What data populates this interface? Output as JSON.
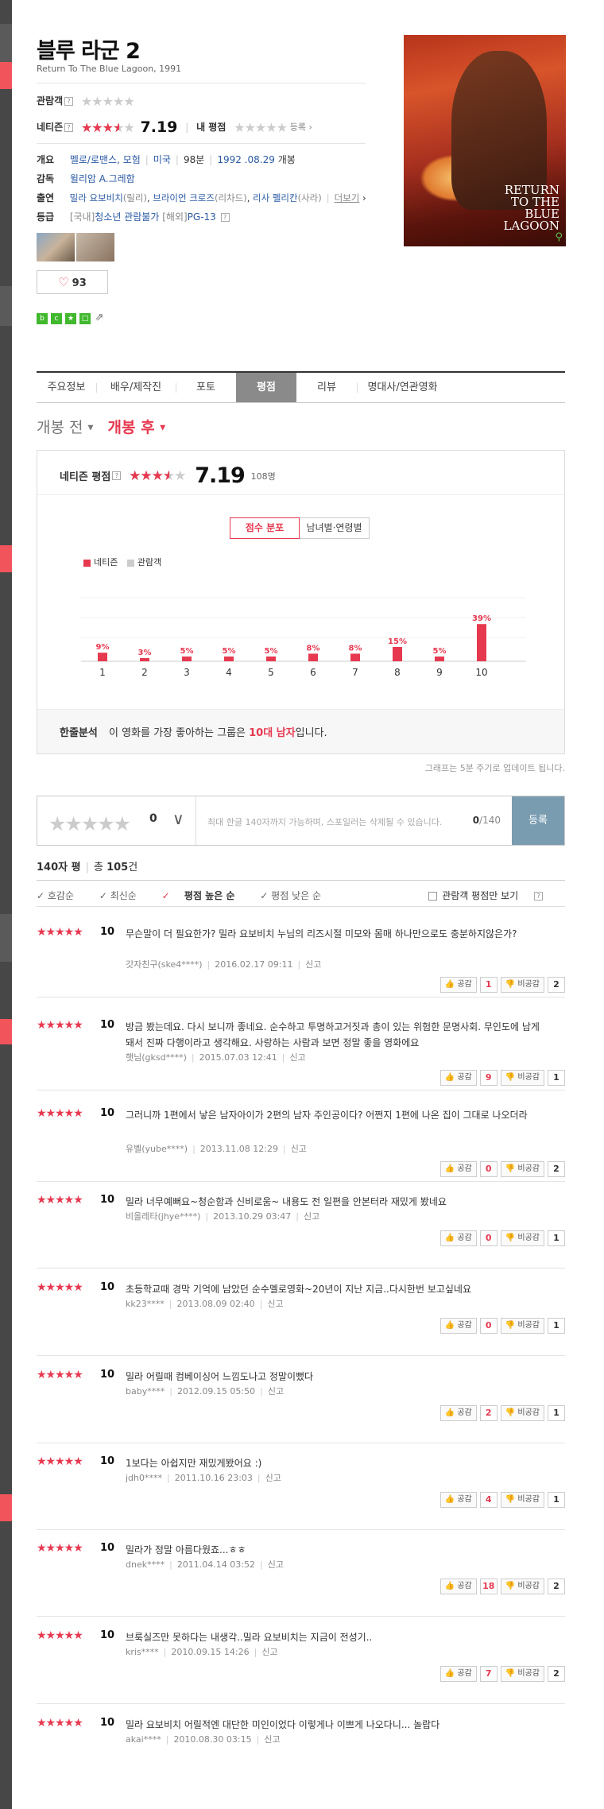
{
  "movie": {
    "title": "블루 라군 2",
    "subtitle": "Return To The Blue Lagoon, 1991",
    "audience_label": "관람객",
    "netizen_label": "네티즌",
    "netizen_score": "7.19",
    "netizen_score_value": 7.19,
    "my_rating_label": "내 평점",
    "register_label": "등록",
    "genre_label": "개요",
    "genres": "멜로/로맨스, 모험",
    "country": "미국",
    "runtime": "98분",
    "release_date": "1992 .08.29",
    "release_suffix": "개봉",
    "director_label": "감독",
    "director": "윌리암 A.그레함",
    "cast_label": "출연",
    "cast_1": "밀라 요보비치",
    "cast_1_role": "(릴리)",
    "cast_2": "브라이언 크로즈",
    "cast_2_role": "(리차드)",
    "cast_3": "리사 펠리칸",
    "cast_3_role": "(사라)",
    "more_label": "더보기",
    "grade_label": "등급",
    "grade_domestic_tag": "[국내]",
    "grade_domestic": "청소년 관람불가",
    "grade_foreign_tag": "[해외]",
    "grade_foreign": "PG-13",
    "likes": "93",
    "poster_text_1": "RETURN",
    "poster_text_2": "TO THE",
    "poster_text_3": "BLUE",
    "poster_text_4": "LAGOON"
  },
  "tabs": [
    "주요정보",
    "배우/제작진",
    "포토",
    "평점",
    "리뷰",
    "명대사/연관영화"
  ],
  "switch": {
    "before": "개봉 전",
    "after": "개봉 후"
  },
  "ratings_box": {
    "label": "네티즌 평점",
    "score": "7.19",
    "count": "108명",
    "seg_on": "점수 분포",
    "seg_off": "남녀별·연령별",
    "legend_netizen": "네티즌",
    "legend_audience": "관람객",
    "analysis_label": "한줄분석",
    "analysis_text_1": "이 영화를 가장 좋아하는 그룹은",
    "analysis_highlight": "10대 남자",
    "analysis_text_2": "입니다."
  },
  "chart_data": {
    "type": "bar",
    "categories": [
      "1",
      "2",
      "3",
      "4",
      "5",
      "6",
      "7",
      "8",
      "9",
      "10"
    ],
    "series": [
      {
        "name": "네티즌",
        "values": [
          9,
          3,
          5,
          5,
          5,
          8,
          8,
          15,
          5,
          39
        ]
      }
    ],
    "value_labels": [
      "9%",
      "3%",
      "5%",
      "5%",
      "5%",
      "8%",
      "8%",
      "15%",
      "5%",
      "39%"
    ],
    "ylim": [
      0,
      100
    ],
    "colors": {
      "netizen": "#e63950",
      "audience": "#cccccc"
    }
  },
  "update_note": "그래프는 5분 주기로 업데이트 됩니다.",
  "writer": {
    "score": "0",
    "placeholder": "최대 한글 140자까지 가능하며, 스포일러는 삭제될 수 있습니다.",
    "count_current": "0",
    "count_max": "/140",
    "submit": "등록"
  },
  "list": {
    "title": "140자 평",
    "total_label": "총",
    "total": "105",
    "total_suffix": "건",
    "sort_1": "호감순",
    "sort_2": "최신순",
    "sort_3": "평점 높은 순",
    "sort_4": "평점 낮은 순",
    "audience_only": "관람객 평점만 보기"
  },
  "reviews": [
    {
      "score": "10",
      "text": "무슨말이 더 필요한가? 밀라 요보비치 누님의 리즈시절 미모와 몸매 하나만으로도 충분하지않은가?",
      "user": "갓자친구(ske4****)",
      "date": "2016.02.17 09:11",
      "report": "신고",
      "like": "공감",
      "like_count": "1",
      "dislike": "비공감",
      "dislike_count": "2"
    },
    {
      "score": "10",
      "text": "방금 봤는데요. 다시 보니까 좋네요. 순수하고 투명하고거짓과 총이 있는 위험한 문명사회. 무인도에 남게돼서 진짜 다행이라고 생각해요. 사랑하는 사람과 보면 정말 좋을 영화에요",
      "user": "햇님(gksd****)",
      "date": "2015.07.03 12:41",
      "report": "신고",
      "like": "공감",
      "like_count": "9",
      "dislike": "비공감",
      "dislike_count": "1"
    },
    {
      "score": "10",
      "text": "그러니까 1편에서 낳은 남자아이가 2편의 남자 주인공이다? 어쩐지 1편에 나온 집이 그대로 나오더라",
      "user": "유벨(yube****)",
      "date": "2013.11.08 12:29",
      "report": "신고",
      "like": "공감",
      "like_count": "0",
      "dislike": "비공감",
      "dislike_count": "2"
    },
    {
      "score": "10",
      "text": "밀라 너무예뻐요~청순함과 신비로움~ 내용도 전 일편을 안본터라 재밌게 봤네요",
      "user": "비올레타(jhye****)",
      "date": "2013.10.29 03:47",
      "report": "신고",
      "like": "공감",
      "like_count": "0",
      "dislike": "비공감",
      "dislike_count": "1"
    },
    {
      "score": "10",
      "text": "초등학교때 경막 기억에 남았던 순수멜로영화~20년이 지난 지금..다시한번 보고싶네요",
      "user": "kk23****",
      "date": "2013.08.09 02:40",
      "report": "신고",
      "like": "공감",
      "like_count": "0",
      "dislike": "비공감",
      "dislike_count": "1"
    },
    {
      "score": "10",
      "text": "밀라 어릴때 컴베이싱어 느낌도나고 정말이뻤다",
      "user": "baby****",
      "date": "2012.09.15 05:50",
      "report": "신고",
      "like": "공감",
      "like_count": "2",
      "dislike": "비공감",
      "dislike_count": "1"
    },
    {
      "score": "10",
      "text": "1보다는 아쉽지만 재밌게봤어요 :)",
      "user": "jdh0****",
      "date": "2011.10.16 23:03",
      "report": "신고",
      "like": "공감",
      "like_count": "4",
      "dislike": "비공감",
      "dislike_count": "1"
    },
    {
      "score": "10",
      "text": "밀라가 정말 아름다웠죠...ㅎㅎ",
      "user": "dnek****",
      "date": "2011.04.14 03:52",
      "report": "신고",
      "like": "공감",
      "like_count": "18",
      "dislike": "비공감",
      "dislike_count": "2"
    },
    {
      "score": "10",
      "text": "브룩실즈만 못하다는 내생각..밀라 요보비치는 지금이 전성기..",
      "user": "kris****",
      "date": "2010.09.15 14:26",
      "report": "신고",
      "like": "공감",
      "like_count": "7",
      "dislike": "비공감",
      "dislike_count": "2"
    },
    {
      "score": "10",
      "text": "밀라 요보비치 어릴적엔 대단한 미인이었다 이렇게나 이쁘게 나오다니... 놀랍다",
      "user": "akai****",
      "date": "2010.08.30 03:15",
      "report": "신고",
      "like": "공감",
      "like_count": "",
      "dislike": "비공감",
      "dislike_count": ""
    }
  ]
}
